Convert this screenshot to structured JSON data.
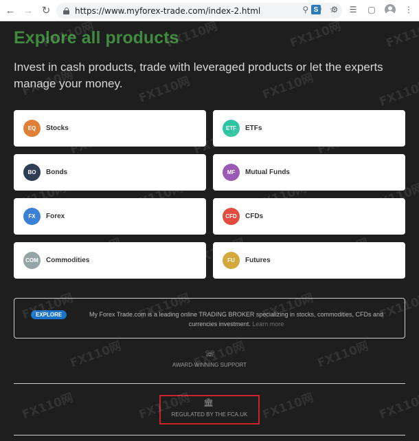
{
  "browser": {
    "url": "https://www.myforex-trade.com/index-2.html"
  },
  "hero": {
    "title": "Explore all products",
    "lead": "Invest in cash products, trade with leveraged products or let the experts manage your money."
  },
  "products": [
    {
      "code": "EQ",
      "label": "Stocks",
      "color": "#e07f36"
    },
    {
      "code": "ETF",
      "label": "ETFs",
      "color": "#2ec4a1"
    },
    {
      "code": "BO",
      "label": "Bonds",
      "color": "#2f3e54"
    },
    {
      "code": "MF",
      "label": "Mutual Funds",
      "color": "#9b59b6"
    },
    {
      "code": "FX",
      "label": "Forex",
      "color": "#3b82d6"
    },
    {
      "code": "CFD",
      "label": "CFDs",
      "color": "#e24b3d"
    },
    {
      "code": "COM",
      "label": "Commodities",
      "color": "#95a5a6"
    },
    {
      "code": "FU",
      "label": "Futures",
      "color": "#d4a83b"
    }
  ],
  "explore": {
    "pill": "EXPLORE",
    "text": "My Forex Trade.com is a leading online TRADING BROKER specializing in stocks, commodities, CFDs and currencies investment.",
    "link": "Learn more"
  },
  "support": {
    "label": "AWARD-WINNING SUPPORT",
    "icon": "headset-icon"
  },
  "regulation": {
    "label": "REGULATED BY THE FCA.UK",
    "icon": "bank-icon",
    "highlight_color": "#c8232c"
  },
  "watermark": "FX110网"
}
